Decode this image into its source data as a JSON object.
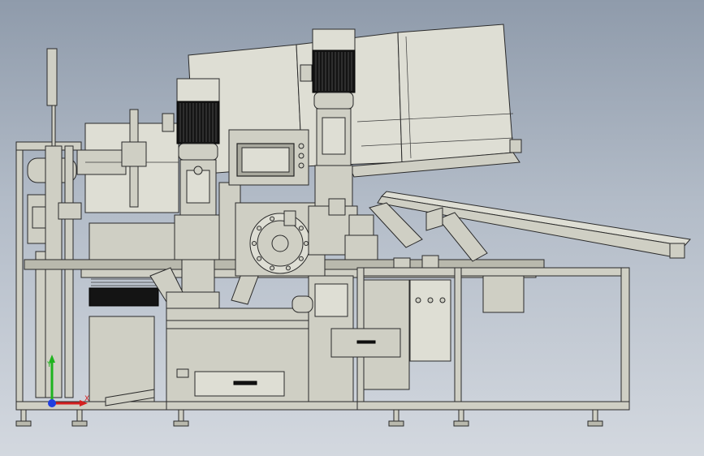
{
  "colors": {
    "background_top": "#8f9bab",
    "background_bottom": "#d3d8df",
    "machine_body": "#cfcfc4",
    "motor": "#141414",
    "axis_x": "#d42020",
    "axis_y": "#1fb31f",
    "axis_z": "#1f3fe0"
  },
  "axes": {
    "x_label": "X",
    "y_label": "Y"
  }
}
